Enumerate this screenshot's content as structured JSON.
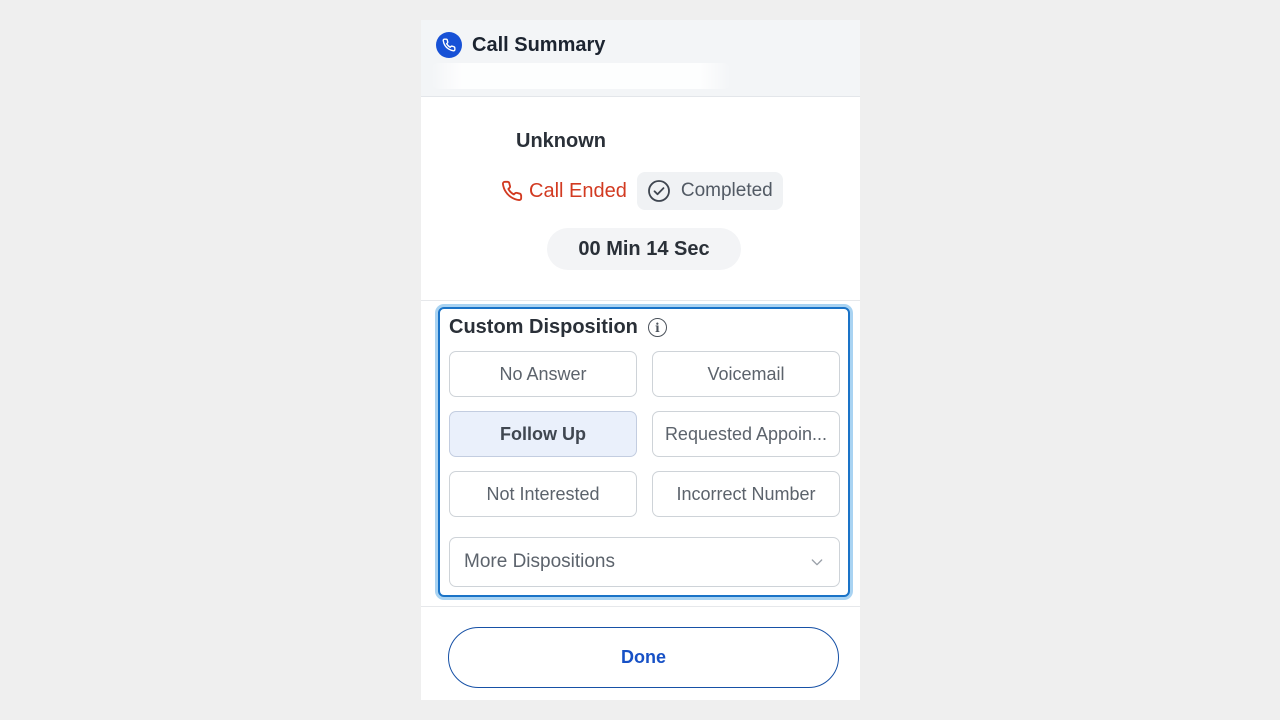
{
  "header": {
    "title": "Call Summary",
    "icon": "phone-icon",
    "accent": "#1751d6"
  },
  "caller": {
    "name": "Unknown"
  },
  "status": {
    "call_state": "Call Ended",
    "call_state_color": "#d23a21",
    "badge": "Completed"
  },
  "duration": "00 Min 14 Sec",
  "disposition": {
    "title": "Custom Disposition",
    "options": [
      {
        "label": "No Answer",
        "selected": false
      },
      {
        "label": "Voicemail",
        "selected": false
      },
      {
        "label": "Follow Up",
        "selected": true
      },
      {
        "label": "Requested Appoin...",
        "selected": false
      },
      {
        "label": "Not Interested",
        "selected": false
      },
      {
        "label": "Incorrect Number",
        "selected": false
      }
    ],
    "more_label": "More Dispositions"
  },
  "actions": {
    "done_label": "Done"
  }
}
